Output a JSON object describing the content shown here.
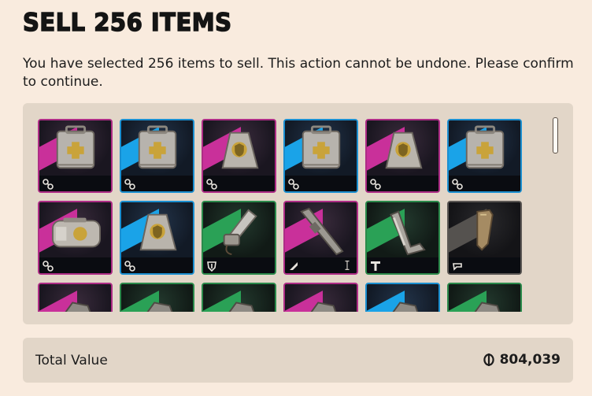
{
  "dialog": {
    "title": "SELL 256 ITEMS",
    "description": "You have selected 256 items to sell. This action cannot be undone. Please confirm to continue."
  },
  "colors": {
    "background": "#f9ebde",
    "panel": "#e2d6c8",
    "rarity_epic": "#ae2d86",
    "rarity_rare": "#1b8fd0",
    "rarity_uncommon": "#2b8a4b",
    "rarity_common": "#5b5754"
  },
  "items": [
    {
      "name": "medical-crate",
      "rarity": "epic",
      "type_icon": "component-icon"
    },
    {
      "name": "medical-crate",
      "rarity": "rare",
      "type_icon": "component-icon"
    },
    {
      "name": "shield-crate",
      "rarity": "epic",
      "type_icon": "component-icon"
    },
    {
      "name": "medical-crate",
      "rarity": "rare",
      "type_icon": "component-icon"
    },
    {
      "name": "shield-crate",
      "rarity": "epic",
      "type_icon": "component-icon"
    },
    {
      "name": "medical-crate",
      "rarity": "rare",
      "type_icon": "component-icon"
    },
    {
      "name": "medical-capsule",
      "rarity": "epic",
      "type_icon": "component-icon"
    },
    {
      "name": "shield-crate",
      "rarity": "rare",
      "type_icon": "component-icon"
    },
    {
      "name": "leg-mod",
      "rarity": "uncommon",
      "type_icon": "shield-mod-icon"
    },
    {
      "name": "rifle-barrel",
      "rarity": "epic",
      "type_icon": "weapon-mod-icon"
    },
    {
      "name": "grip-handle",
      "rarity": "uncommon",
      "type_icon": "tool-icon"
    },
    {
      "name": "stock-part",
      "rarity": "common",
      "type_icon": "stock-icon"
    },
    {
      "name": "partial-item",
      "rarity": "epic",
      "type_icon": ""
    },
    {
      "name": "partial-item",
      "rarity": "uncommon",
      "type_icon": ""
    },
    {
      "name": "partial-item",
      "rarity": "uncommon",
      "type_icon": ""
    },
    {
      "name": "partial-item",
      "rarity": "epic",
      "type_icon": ""
    },
    {
      "name": "partial-item",
      "rarity": "rare",
      "type_icon": ""
    },
    {
      "name": "partial-item",
      "rarity": "uncommon",
      "type_icon": ""
    }
  ],
  "total": {
    "label": "Total Value",
    "currency_icon": "credits-icon",
    "value": "804,039"
  }
}
